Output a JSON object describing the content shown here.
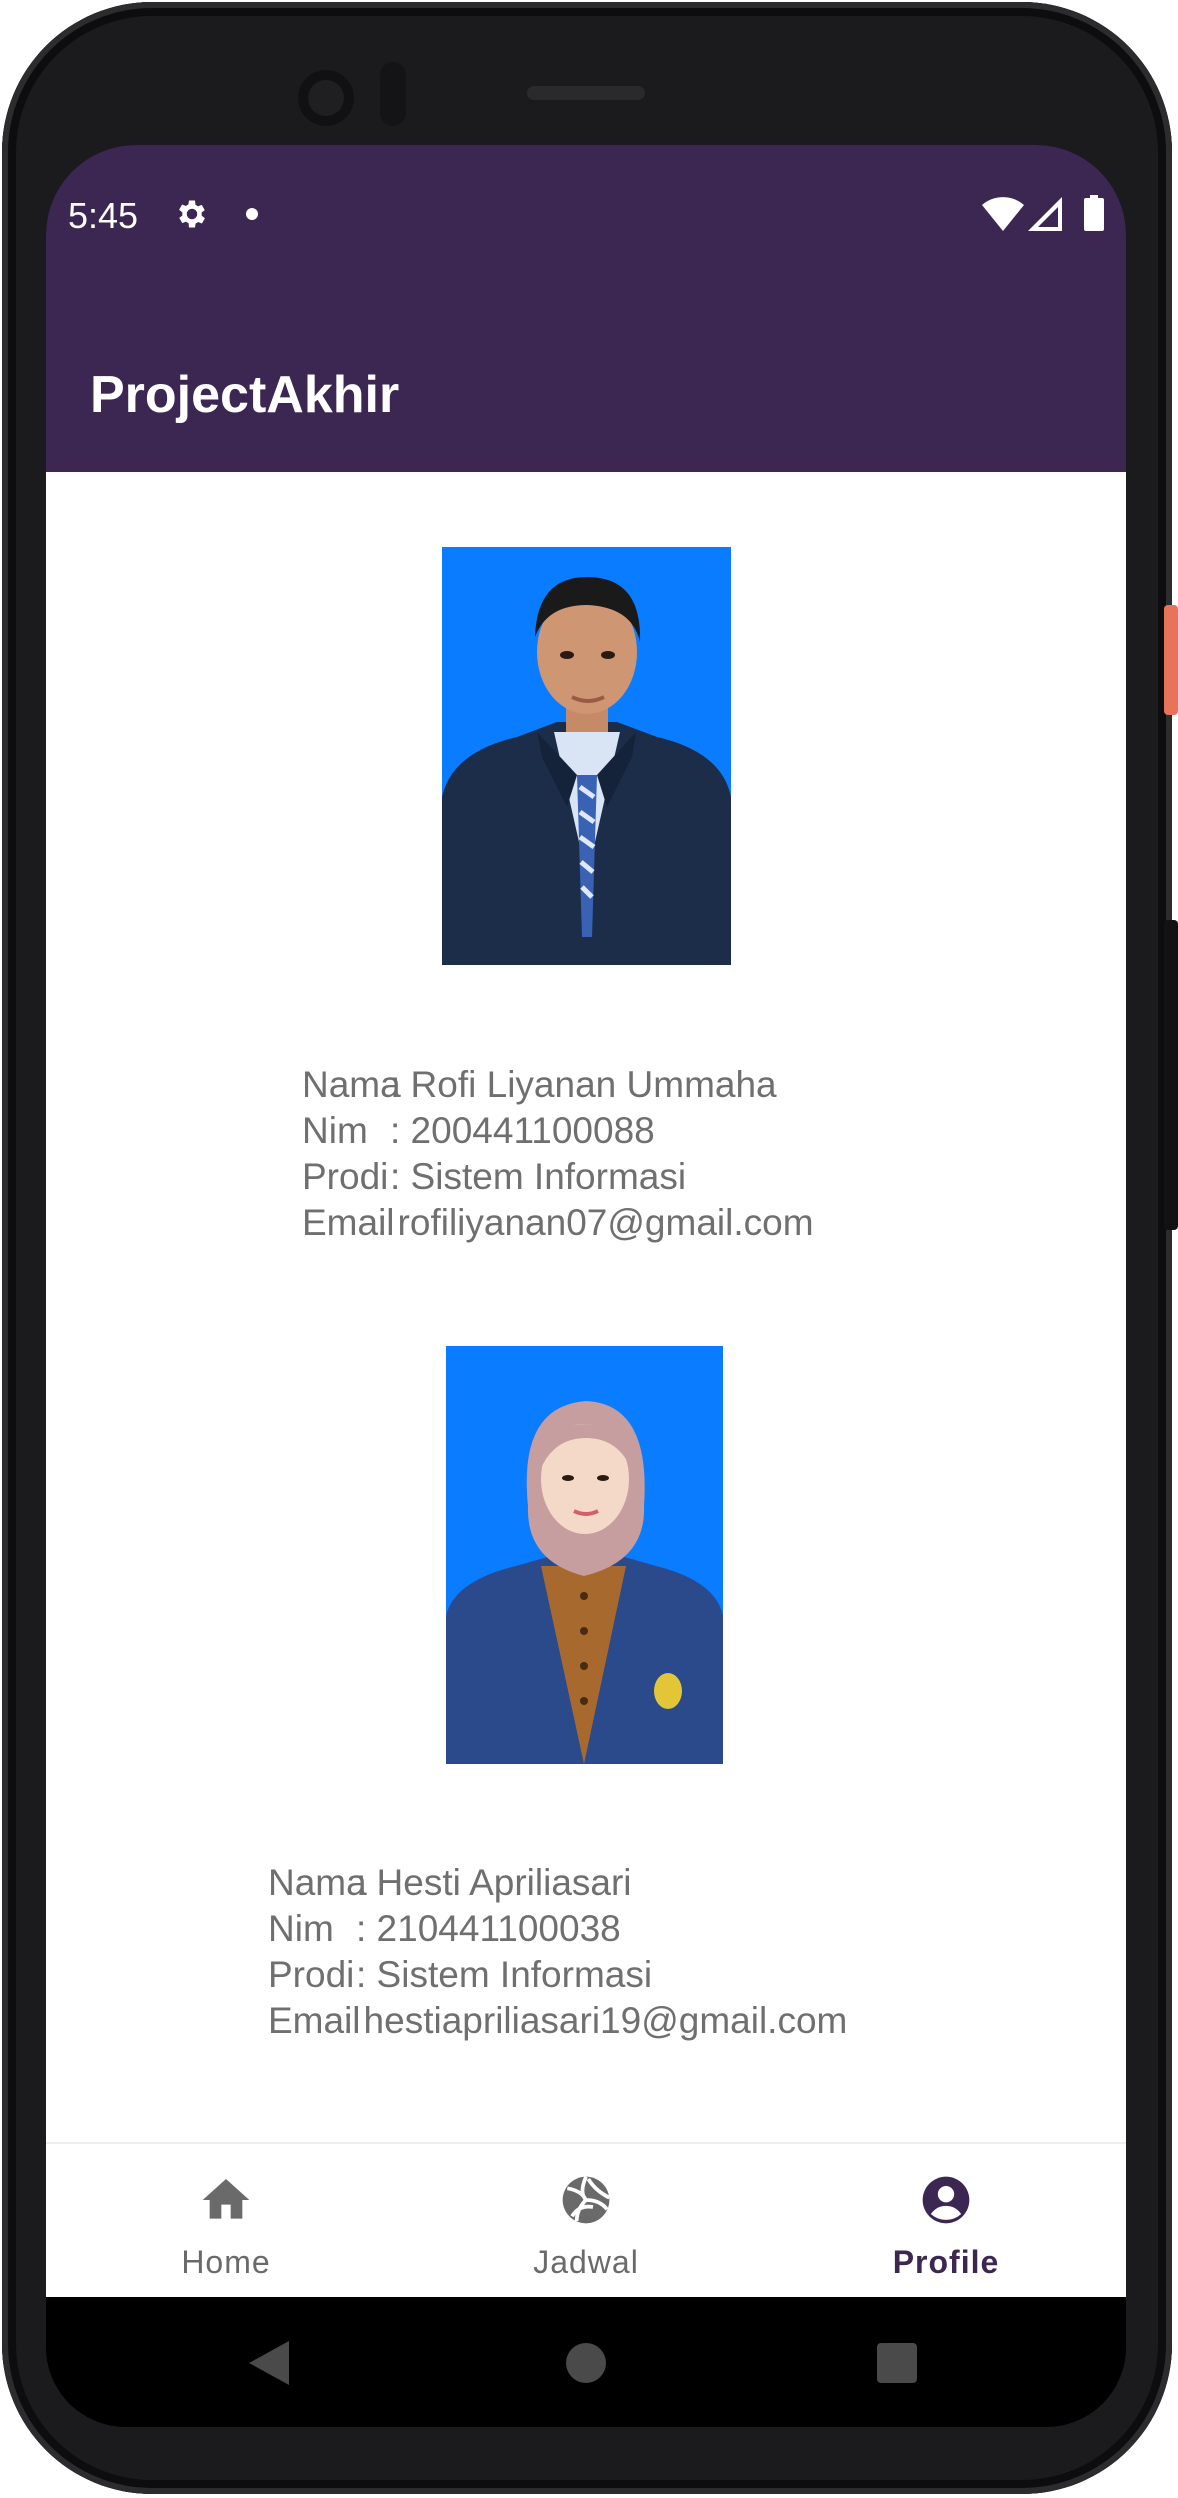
{
  "status_bar": {
    "time": "5:45"
  },
  "app_bar": {
    "title": "ProjectAkhir"
  },
  "profiles": [
    {
      "photo_icon": "portrait-man-blue-background",
      "rows": [
        {
          "label": "Nama",
          "value": ": Rofi Liyanan Ummaha"
        },
        {
          "label": "Nim",
          "value": ": 200441100088"
        },
        {
          "label": "Prodi",
          "value": ": Sistem Informasi"
        },
        {
          "label": "Email",
          "value": ": rofiliyanan07@gmail.com"
        }
      ]
    },
    {
      "photo_icon": "portrait-woman-hijab-blue-background",
      "rows": [
        {
          "label": "Nama",
          "value": ": Hesti Apriliasari"
        },
        {
          "label": "Nim",
          "value": ": 210441100038"
        },
        {
          "label": "Prodi",
          "value": ": Sistem Informasi"
        },
        {
          "label": "Email",
          "value": ": hestiapriliasari19@gmail.com"
        }
      ]
    }
  ],
  "bottom_nav": {
    "items": [
      {
        "label": "Home",
        "icon": "home-icon",
        "active": false
      },
      {
        "label": "Jadwal",
        "icon": "volleyball-icon",
        "active": false
      },
      {
        "label": "Profile",
        "icon": "account-circle-icon",
        "active": true
      }
    ]
  },
  "colors": {
    "app_bar": "#3b2751",
    "photo_background": "#0a7cff",
    "info_text": "#6f6f6f",
    "nav_active": "#3b2751",
    "nav_inactive": "#6a6a6a"
  }
}
